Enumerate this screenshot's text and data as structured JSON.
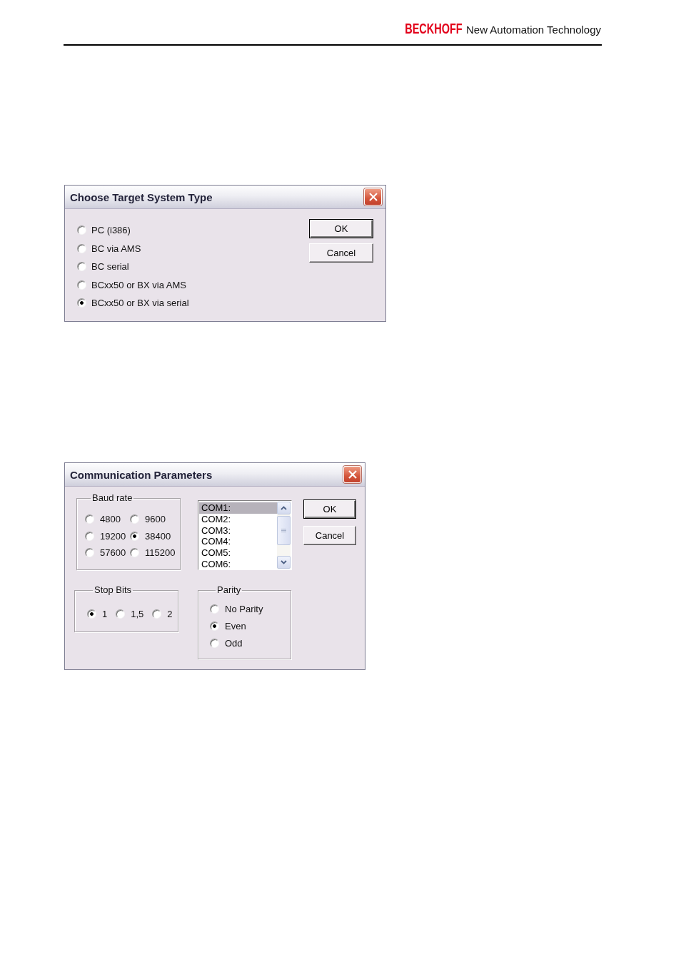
{
  "header": {
    "brand": "BECKHOFF",
    "tagline": "New Automation Technology"
  },
  "target_dialog": {
    "title": "Choose Target System Type",
    "options": [
      {
        "label": "PC (i386)",
        "selected": false
      },
      {
        "label": "BC via AMS",
        "selected": false
      },
      {
        "label": "BC serial",
        "selected": false
      },
      {
        "label": "BCxx50 or BX via AMS",
        "selected": false
      },
      {
        "label": "BCxx50 or BX via serial",
        "selected": true
      }
    ],
    "buttons": [
      {
        "label": "OK",
        "default": true
      },
      {
        "label": "Cancel",
        "default": false
      }
    ]
  },
  "comm_dialog": {
    "title": "Communication Parameters",
    "baud_rate": {
      "label": "Baud rate",
      "options": [
        {
          "label": "4800",
          "selected": false
        },
        {
          "label": "9600",
          "selected": false
        },
        {
          "label": "19200",
          "selected": false
        },
        {
          "label": "38400",
          "selected": true
        },
        {
          "label": "57600",
          "selected": false
        },
        {
          "label": "115200",
          "selected": false
        }
      ]
    },
    "ports": [
      {
        "label": "COM1:",
        "selected": true
      },
      {
        "label": "COM2:",
        "selected": false
      },
      {
        "label": "COM3:",
        "selected": false
      },
      {
        "label": "COM4:",
        "selected": false
      },
      {
        "label": "COM5:",
        "selected": false
      },
      {
        "label": "COM6:",
        "selected": false
      }
    ],
    "buttons": [
      {
        "label": "OK",
        "default": true
      },
      {
        "label": "Cancel",
        "default": false
      }
    ],
    "stop_bits": {
      "label": "Stop Bits",
      "options": [
        {
          "label": "1",
          "selected": true
        },
        {
          "label": "1,5",
          "selected": false
        },
        {
          "label": "2",
          "selected": false
        }
      ]
    },
    "parity": {
      "label": "Parity",
      "options": [
        {
          "label": "No Parity",
          "selected": false
        },
        {
          "label": "Even",
          "selected": true
        },
        {
          "label": "Odd",
          "selected": false
        }
      ]
    }
  }
}
